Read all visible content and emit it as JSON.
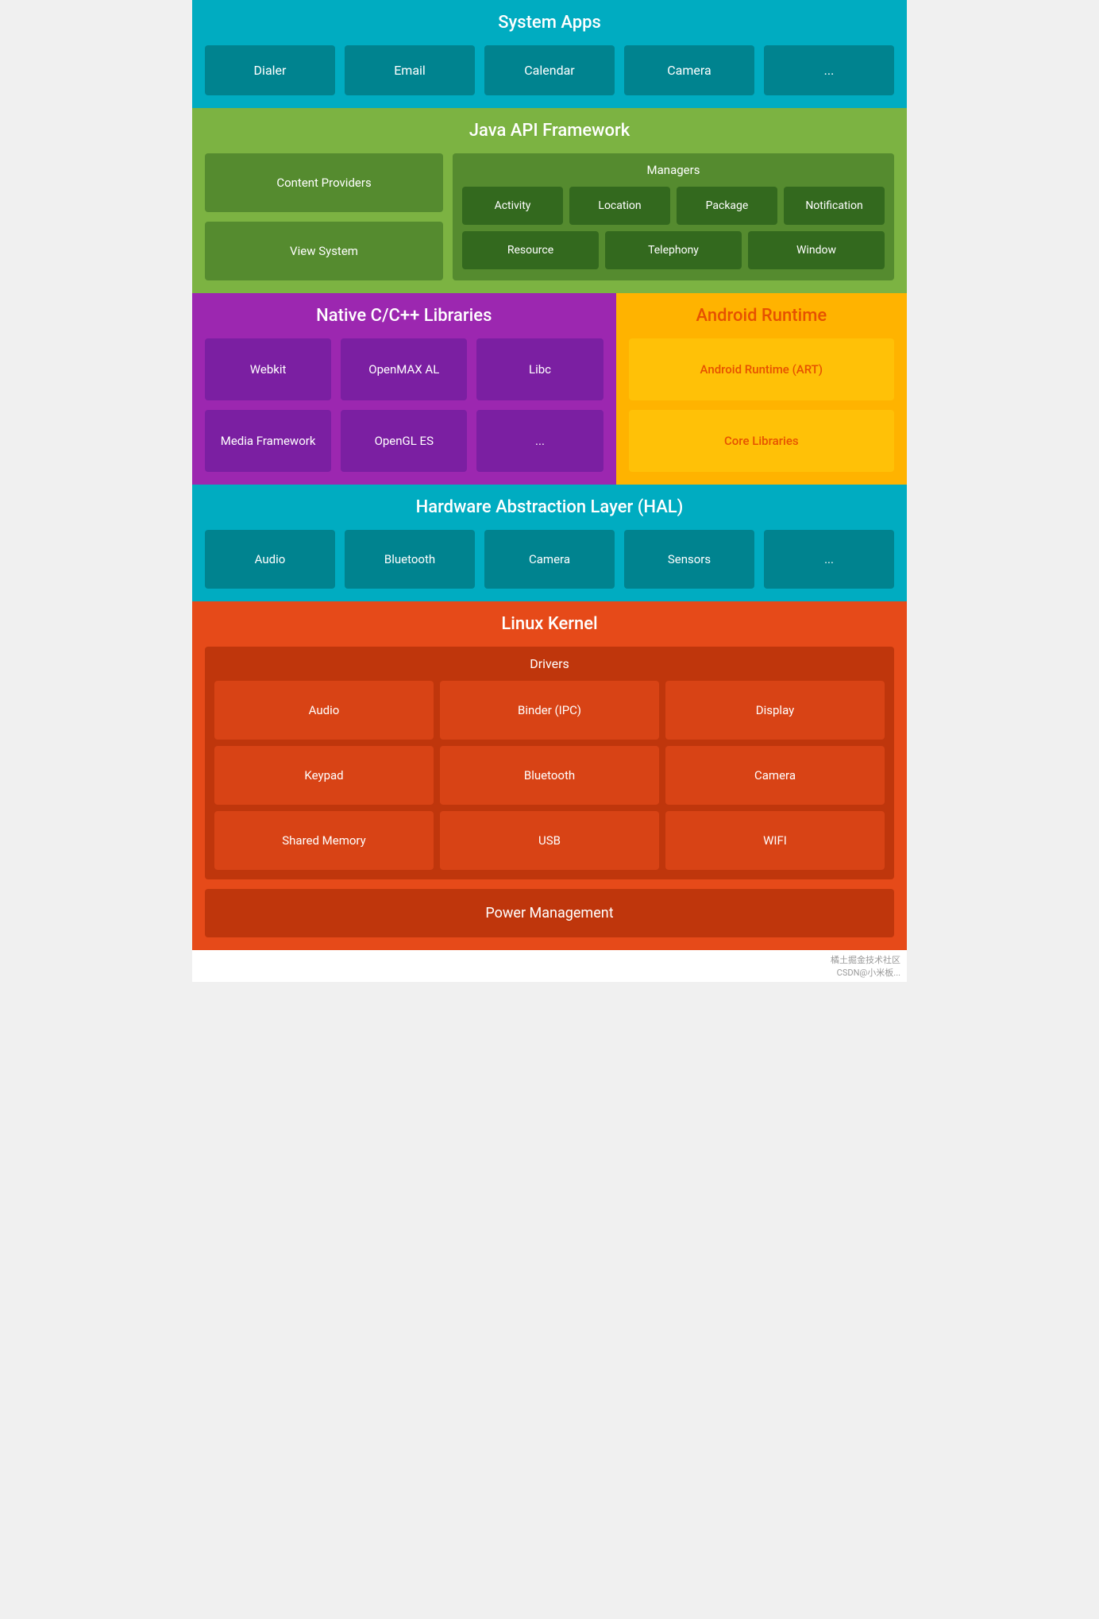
{
  "system_apps": {
    "title": "System Apps",
    "cells": [
      "Dialer",
      "Email",
      "Calendar",
      "Camera",
      "..."
    ]
  },
  "java_api": {
    "title": "Java API Framework",
    "left": {
      "items": [
        "Content Providers",
        "View System"
      ]
    },
    "right": {
      "title": "Managers",
      "row1": [
        "Activity",
        "Location",
        "Package",
        "Notification"
      ],
      "row2": [
        "Resource",
        "Telephony",
        "Window"
      ]
    }
  },
  "native": {
    "title": "Native C/C++ Libraries",
    "cells": [
      "Webkit",
      "OpenMAX AL",
      "Libc",
      "Media Framework",
      "OpenGL ES",
      "..."
    ]
  },
  "runtime": {
    "title": "Android Runtime",
    "cells": [
      "Android Runtime (ART)",
      "Core Libraries"
    ]
  },
  "hal": {
    "title": "Hardware Abstraction Layer (HAL)",
    "cells": [
      "Audio",
      "Bluetooth",
      "Camera",
      "Sensors",
      "..."
    ]
  },
  "kernel": {
    "title": "Linux Kernel",
    "drivers_title": "Drivers",
    "drivers": [
      "Audio",
      "Binder (IPC)",
      "Display",
      "Keypad",
      "Bluetooth",
      "Camera",
      "Shared Memory",
      "USB",
      "WIFI"
    ],
    "power": "Power Management"
  },
  "watermark": {
    "line1": "橘土掘金技术社区",
    "line2": "CSDN@小米板..."
  }
}
